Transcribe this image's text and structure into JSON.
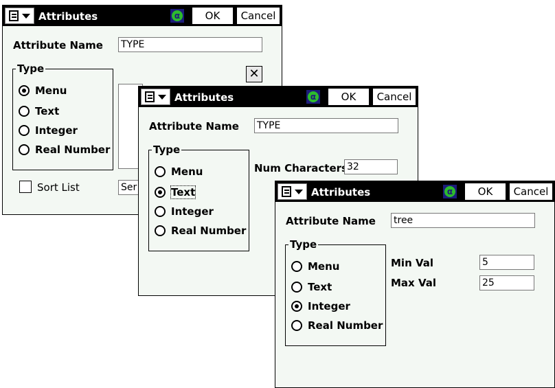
{
  "windows": [
    {
      "title": "Attributes",
      "ok_label": "OK",
      "cancel_label": "Cancel",
      "attribute_name_label": "Attribute Name",
      "attribute_name_value": "TYPE",
      "type_group_label": "Type",
      "type_options": [
        "Menu",
        "Text",
        "Integer",
        "Real Number"
      ],
      "selected_type": "Menu",
      "sort_list_label": "Sort List",
      "sort_list_checked": false,
      "field_fragment": "Ser"
    },
    {
      "title": "Attributes",
      "ok_label": "OK",
      "cancel_label": "Cancel",
      "attribute_name_label": "Attribute Name",
      "attribute_name_value": "TYPE",
      "type_group_label": "Type",
      "type_options": [
        "Menu",
        "Text",
        "Integer",
        "Real Number"
      ],
      "selected_type": "Text",
      "num_characters_label": "Num Characters",
      "num_characters_value": "32"
    },
    {
      "title": "Attributes",
      "ok_label": "OK",
      "cancel_label": "Cancel",
      "attribute_name_label": "Attribute Name",
      "attribute_name_value": "tree",
      "type_group_label": "Type",
      "type_options": [
        "Menu",
        "Text",
        "Integer",
        "Real Number"
      ],
      "selected_type": "Integer",
      "min_val_label": "Min Val",
      "min_val_value": "5",
      "max_val_label": "Max Val",
      "max_val_value": "25"
    }
  ],
  "icons": {
    "menu": "start-menu-icon",
    "input_mode": "alpha-input-icon",
    "delete": "close-x-icon"
  },
  "colors": {
    "titlebar": "#000000",
    "window_bg": "#f3f8f3",
    "alpha_icon_bg": "#1c1c7a",
    "alpha_icon_fg": "#2dbb2d"
  }
}
